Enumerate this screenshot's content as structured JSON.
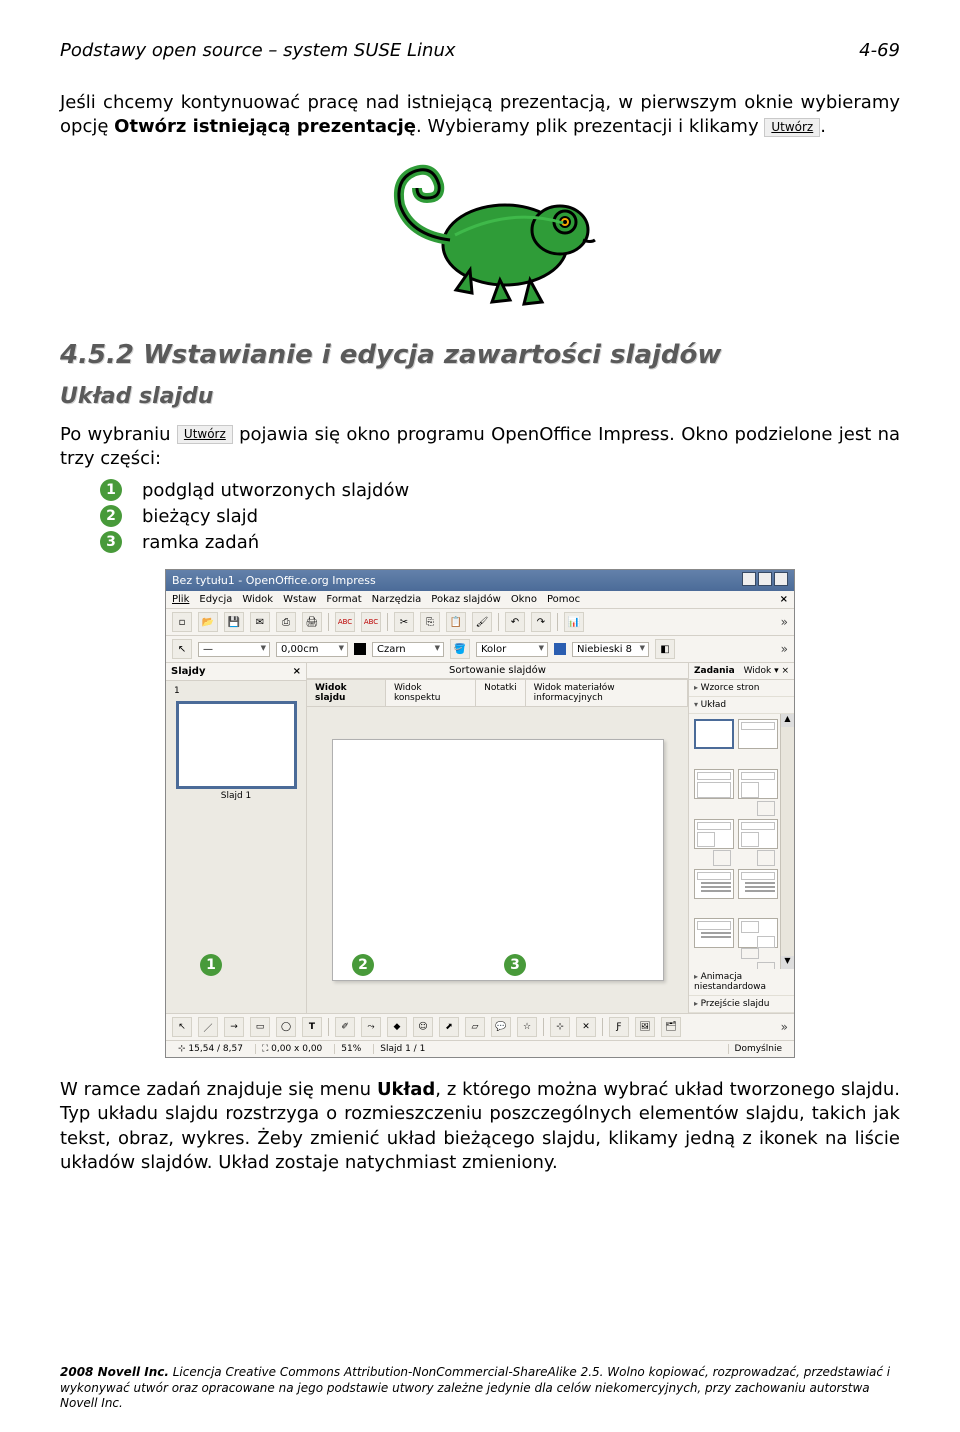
{
  "header": {
    "left": "Podstawy open source – system SUSE Linux",
    "right": "4-69"
  },
  "intro": {
    "t1": "Jeśli chcemy kontynuować pracę nad istniejącą prezentacją, w pierwszym oknie wybieramy opcję ",
    "bold1": "Otwórz istniejącą prezentację",
    "t2": ". Wybieramy plik prezentacji i klikamy ",
    "btn": "Utwórz",
    "t3": "."
  },
  "h2": "4.5.2 Wstawianie i edycja zawartości slajdów",
  "h3": "Układ slajdu",
  "para2": {
    "t1": "Po wybraniu ",
    "btn": "Utwórz",
    "t2": " pojawia się okno programu OpenOffice Impress. Okno podzielone jest na trzy części:"
  },
  "list": {
    "i1": "podgląd utworzonych slajdów",
    "i2": "bieżący slajd",
    "i3": "ramka zadań"
  },
  "app": {
    "title": "Bez tytułu1 - OpenOffice.org Impress",
    "menu": {
      "m1": "Plik",
      "m2": "Edycja",
      "m3": "Widok",
      "m4": "Wstaw",
      "m5": "Format",
      "m6": "Narzędzia",
      "m7": "Pokaz slajdów",
      "m8": "Okno",
      "m9": "Pomoc"
    },
    "tb2": {
      "width": "0,00cm",
      "sty": "Czarn",
      "kolor_lbl": "Kolor",
      "kolor_val": "Niebieski 8"
    },
    "slides_panel": {
      "title": "Slajdy",
      "thumb": "Slajd 1"
    },
    "center": {
      "sort": "Sortowanie slajdów",
      "tab1": "Widok slajdu",
      "tab2": "Widok konspektu",
      "tab3": "Notatki",
      "tab4": "Widok materiałów informacyjnych"
    },
    "tasks": {
      "title": "Zadania",
      "view": "Widok",
      "s1": "Wzorce stron",
      "s2": "Układ",
      "s3": "Animacja niestandardowa",
      "s4": "Przejście slajdu"
    },
    "status": {
      "pos": "15,54 / 8,57",
      "xy": "0,00 x 0,00",
      "zoom": "51%",
      "slide": "Slajd 1 / 1",
      "mode": "Domyślnie"
    }
  },
  "para3": {
    "t1": "W ramce zadań znajduje się menu ",
    "bold1": "Układ",
    "t2": ", z którego można wybrać układ tworzonego slajdu. Typ układu slajdu rozstrzyga o rozmieszczeniu poszczególnych elementów slajdu, takich jak tekst, obraz, wykres. Żeby zmienić układ bieżącego slajdu, klikamy jedną z ikonek na liście układów slajdów. Układ zostaje natychmiast zmieniony."
  },
  "footer": {
    "l1": "2008 Novell Inc.",
    "l2": " Licencja Creative Commons Attribution-NonCommercial-ShareAlike 2.5. Wolno kopiować, rozprowadzać, przedstawiać i wykonywać utwór oraz opracowane na jego podstawie utwory zależne jedynie dla celów niekomercyjnych, przy zachowaniu autorstwa Novell Inc."
  }
}
